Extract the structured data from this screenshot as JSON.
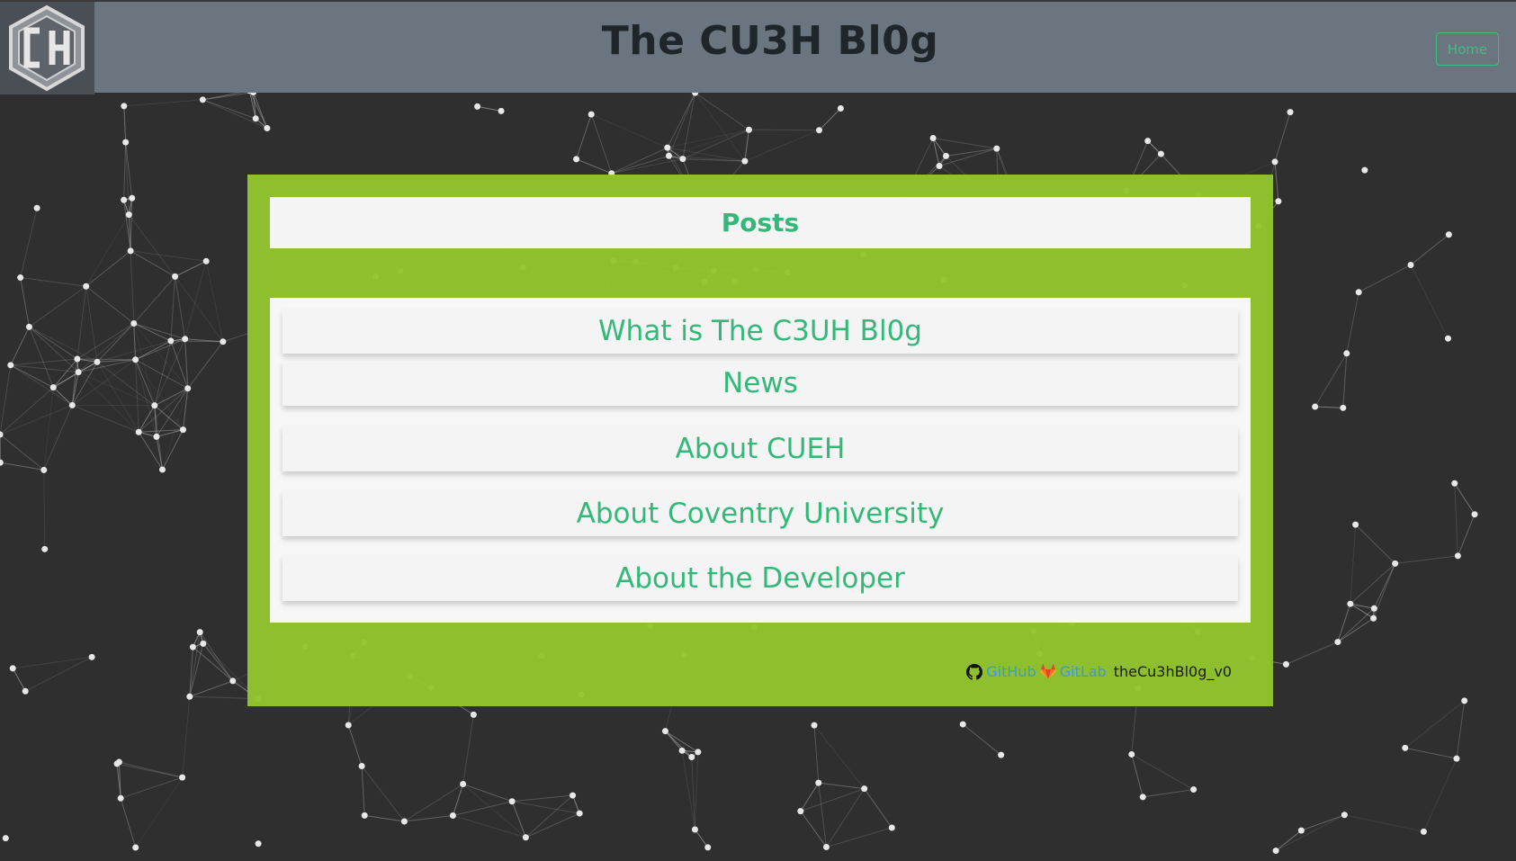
{
  "header": {
    "title": "The CU3H Bl0g",
    "logo_icon": "cueh-hexagon-logo-icon",
    "home_label": "Home"
  },
  "posts": {
    "heading": "Posts",
    "items": [
      {
        "label": "What is The C3UH Bl0g"
      },
      {
        "label": "News"
      },
      {
        "label": "About CUEH"
      },
      {
        "label": "About Coventry University"
      },
      {
        "label": "About the Developer"
      }
    ]
  },
  "footer": {
    "github_icon": "github-icon",
    "github_label": "GitHub",
    "gitlab_icon": "gitlab-icon",
    "gitlab_label": "GitLab",
    "version": "theCu3hBl0g_v0"
  },
  "colors": {
    "accent": "#34b87a",
    "panel": "#92c42e",
    "header": "#6b7580",
    "background": "#2f2f2f"
  }
}
